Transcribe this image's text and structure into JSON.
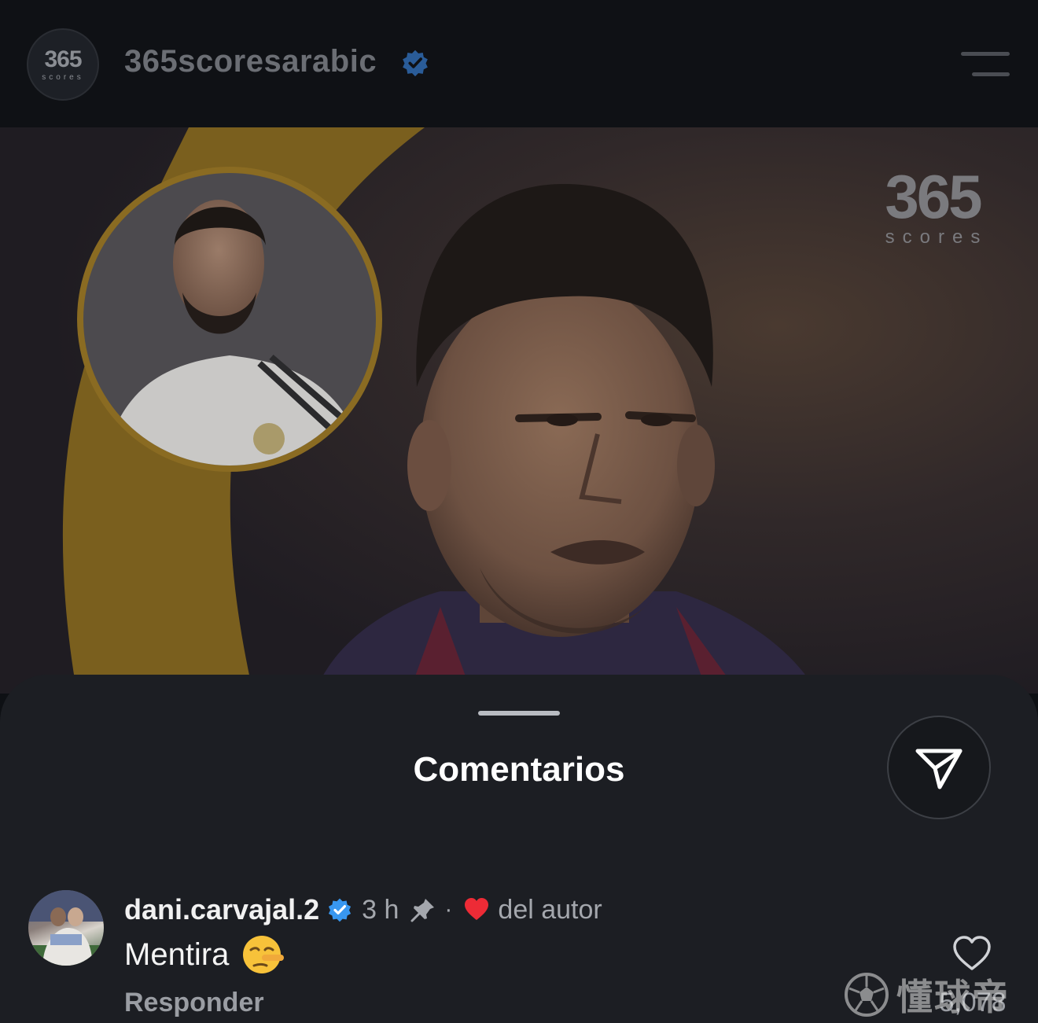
{
  "header": {
    "avatar_big": "365",
    "avatar_small": "scores",
    "username": "365scoresarabic",
    "menu_icon": "hamburger-menu-icon",
    "verified_icon": "verified-badge-icon"
  },
  "post": {
    "watermark_big": "365",
    "watermark_small": "scores",
    "accent_color": "#c9a227"
  },
  "comments_sheet": {
    "title": "Comentarios",
    "share_icon": "send-icon"
  },
  "comment": {
    "username": "dani.carvajal.2",
    "time": "3 h",
    "separator": "·",
    "liked_by_author": "del autor",
    "text": "Mentira",
    "emoji": "lying-face-emoji",
    "reply_label": "Responder",
    "like_count": "5,078",
    "icons": {
      "verified": "verified-badge-icon",
      "pin": "pin-icon",
      "heart": "heart-red-icon",
      "like": "heart-outline-icon"
    }
  },
  "site_watermark": {
    "text": "懂球帝",
    "icon": "soccer-ball-icon"
  },
  "colors": {
    "background": "#0e1014",
    "sheet": "#1c1e23",
    "verified_blue": "#3897f0",
    "heart_red": "#ed2b36"
  }
}
